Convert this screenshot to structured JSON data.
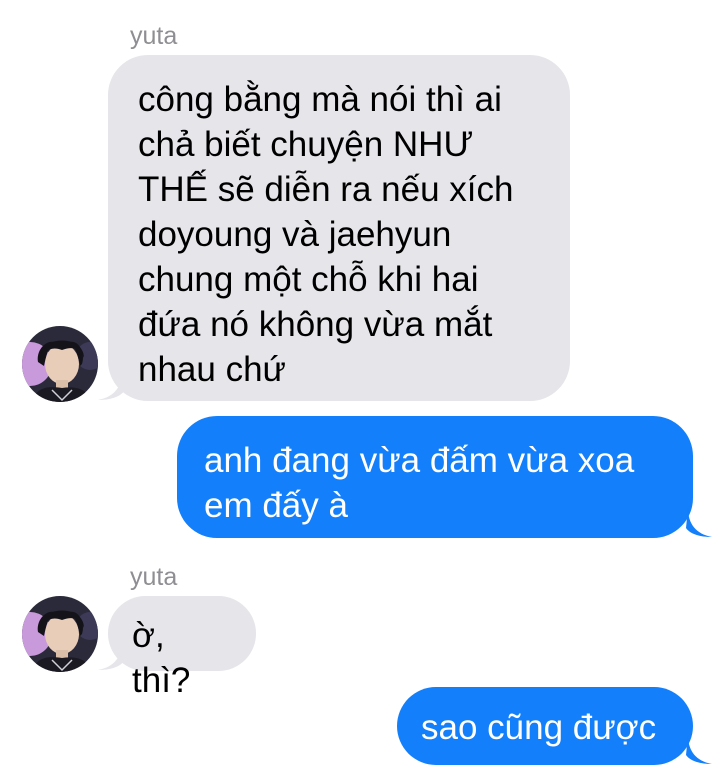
{
  "thread": {
    "messages": [
      {
        "direction": "incoming",
        "sender": "yuta",
        "text": "công bằng mà nói thì ai\nchả biết chuyện NHƯ\nTHẾ sẽ diễn ra nếu xích\ndoyoung và jaehyun\nchung một chỗ khi hai\nđứa nó không vừa mắt\nnhau chứ"
      },
      {
        "direction": "outgoing",
        "text": "anh đang vừa đấm vừa xoa\nem đấy à"
      },
      {
        "direction": "incoming",
        "sender": "yuta",
        "text": "ờ, thì?"
      },
      {
        "direction": "outgoing",
        "text": "sao cũng được"
      }
    ]
  },
  "colors": {
    "incoming_bubble": "#e5e5ea",
    "outgoing_bubble": "#137ffa",
    "sender_name": "#8e8e93"
  },
  "icons": {
    "avatar": "contact-avatar-photo"
  }
}
